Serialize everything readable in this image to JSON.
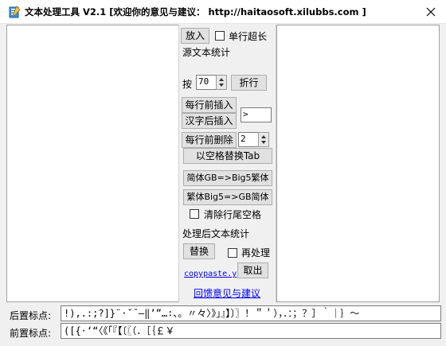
{
  "window": {
    "title": "文本处理工具 V2.1 [欢迎你的意见与建议：  http://haitaosoft.xilubbs.com ]",
    "app_icon": "notepad-icon",
    "close_icon": "close-icon"
  },
  "panel": {
    "enlarge_button": "放入",
    "single_line_long_label": "单行超长",
    "single_line_long_checked": false,
    "source_stats_label": "源文本统计",
    "by_label": "按",
    "wrap_width_value": "70",
    "wrap_button": "折行",
    "prefix_insert_button": "每行前插入",
    "after_hanzi_insert_button": "汉字后插入",
    "insert_text_value": ">",
    "delete_prefix_button": "每行前删除",
    "delete_count_value": "2",
    "space_to_tab_button": "以空格替换Tab",
    "gb_to_big5_button": "简体GB=>Big5繁体",
    "big5_to_gb_button": "繁体Big5=>GB简体",
    "trim_trailing_label": "清除行尾空格",
    "trim_trailing_checked": false,
    "processed_stats_label": "处理后文本统计",
    "replace_button": "替换",
    "reprocess_label": "再处理",
    "reprocess_checked": false,
    "copypaste_link": "copypaste.y",
    "take_out_button": "取出",
    "feedback_link": "回馈意见与建议"
  },
  "bottom": {
    "suffix_punct_label": "后置标点:",
    "suffix_punct_value": "!),.:;?]}¨·ˇˉ―‖’”…∶、。〃々〉》」』】〕〗！＂＇），．：；？］｀｜｝～",
    "prefix_punct_label": "前置标点:",
    "prefix_punct_value": "([{·‘“〈《「『【〔〖（．［｛￡￥"
  }
}
